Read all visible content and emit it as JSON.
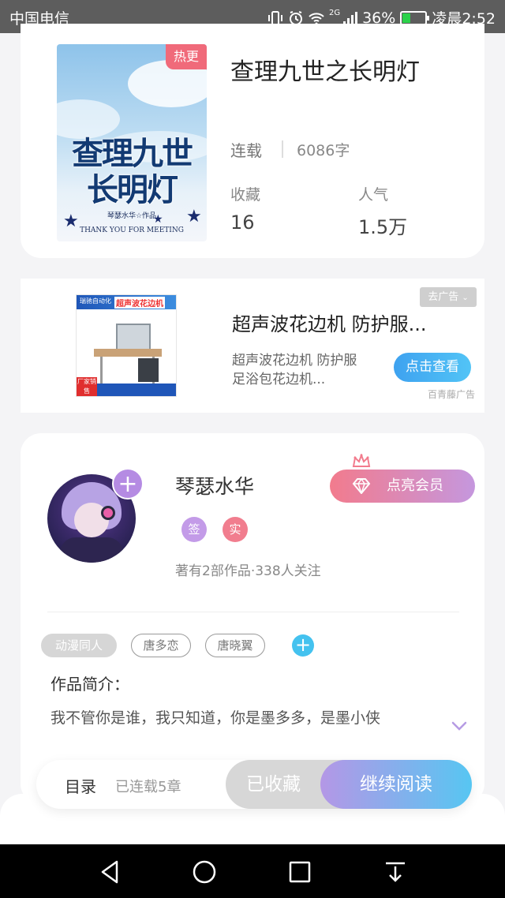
{
  "status_bar": {
    "carrier": "中国电信",
    "network": "2G",
    "battery": "36%",
    "battery_level": 0.36,
    "time": "凌晨2:52"
  },
  "book": {
    "cover_title_line1": "查理九世",
    "cover_title_line2": "长明灯",
    "cover_byline": "琴瑟水华☆作品",
    "cover_tagline": "THANK YOU FOR MEETING",
    "hot_badge": "热更",
    "title": "查理九世之长明灯",
    "status": "连载",
    "word_count": "6086字",
    "favorites_label": "收藏",
    "favorites_value": "16",
    "popularity_label": "人气",
    "popularity_value": "1.5万"
  },
  "ad": {
    "image_brand": "瑞驰自动化",
    "image_headline": "超声波花边机",
    "image_badge": "厂家销售",
    "dismiss_label": "去广告",
    "title": "超声波花边机 防护服...",
    "description": "超声波花边机 防护服足浴包花边机...",
    "cta": "点击查看",
    "source": "百青藤广告"
  },
  "author": {
    "name": "琴瑟水华",
    "badge_sign": "签",
    "badge_verified": "实",
    "meta": "著有2部作品·338人关注",
    "vip_button": "点亮会员",
    "tags": [
      "动漫同人",
      "唐多恋",
      "唐晓翼"
    ],
    "intro_label": "作品简介：",
    "intro_text": "我不管你是谁，我只知道，你是墨多多，是墨小侠"
  },
  "bottom_bar": {
    "toc_label": "目录",
    "toc_count": "已连载5章",
    "collected_label": "已收藏",
    "read_label": "继续阅读"
  },
  "colors": {
    "accent_pink": "#f06a7a",
    "accent_purple": "#b497e6",
    "accent_blue": "#57c6f2"
  }
}
